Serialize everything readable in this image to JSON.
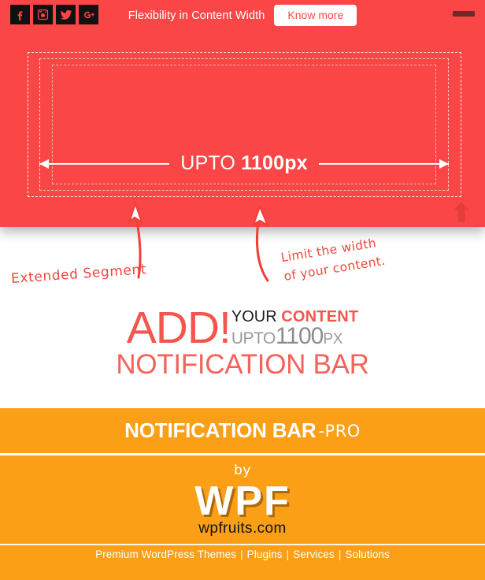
{
  "notification_bar": {
    "message": "Flexibility in Content Width",
    "cta_label": "Know more",
    "toggle_name": "minimize-bar",
    "social": [
      {
        "name": "facebook-icon",
        "label": "f"
      },
      {
        "name": "instagram-icon",
        "label": "Instagram"
      },
      {
        "name": "twitter-icon",
        "label": "Twitter"
      },
      {
        "name": "googleplus-icon",
        "label": "g+"
      }
    ],
    "width_label_prefix": "UPTO",
    "width_label_value": "1100px",
    "scroll_top_name": "scroll-to-top"
  },
  "annotations": {
    "left": "Extended Segment",
    "right_line1": "Limit the width",
    "right_line2": "of your content."
  },
  "headline": {
    "add": "ADD!",
    "your": "YOUR",
    "content": "CONTENT",
    "upto": "UPTO",
    "value": "1100",
    "unit": "PX",
    "subtitle": "NOTIFICATION BAR"
  },
  "pro_banner": {
    "title": "NOTIFICATION BAR",
    "suffix": "-PRO"
  },
  "logo": {
    "by": "by",
    "brand": "WPF",
    "url": "wpfruits.com"
  },
  "footer": {
    "links": [
      "Premium WordPress Themes",
      "Plugins",
      "Services",
      "Solutions"
    ],
    "separator": "|"
  },
  "colors": {
    "red": "#fa4646",
    "red_text": "#f4564e",
    "orange": "#fb9f17",
    "white": "#ffffff",
    "gray": "#9a9a9a",
    "dark": "#1c1c1c"
  }
}
